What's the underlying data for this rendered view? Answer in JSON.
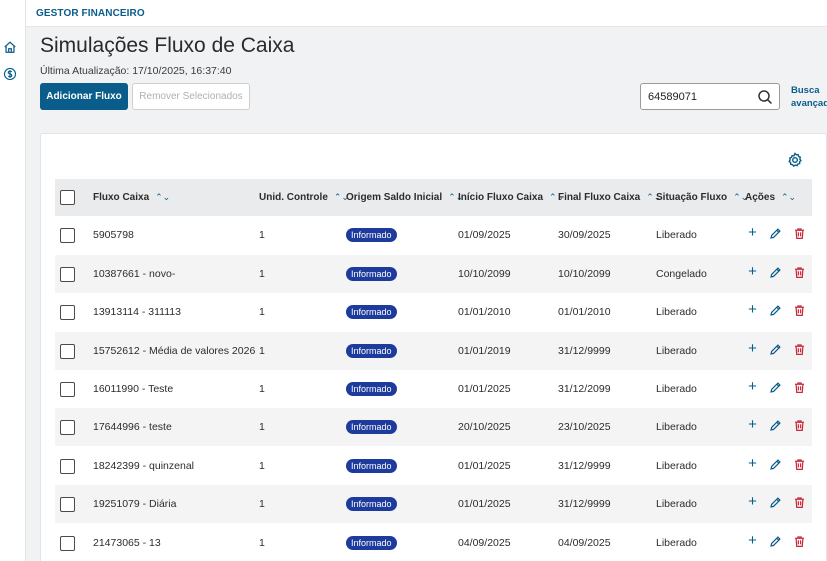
{
  "app": {
    "brand": "GESTOR FINANCEIRO"
  },
  "page": {
    "title": "Simulações Fluxo de Caixa",
    "last_update": "Última Atualização: 17/10/2025, 16:37:40"
  },
  "toolbar": {
    "add_label": "Adicionar Fluxo",
    "remove_label": "Remover Selecionados"
  },
  "search": {
    "value": "64589071",
    "advanced_label": "Busca avançada"
  },
  "table": {
    "columns": [
      "Fluxo Caixa",
      "Unid. Controle",
      "Origem Saldo Inicial",
      "Início Fluxo Caixa",
      "Final Fluxo Caixa",
      "Situação Fluxo",
      "Ações"
    ],
    "rows": [
      {
        "fluxo": "5905798",
        "unid": "1",
        "origem": "Informado",
        "inicio": "01/09/2025",
        "final": "30/09/2025",
        "situacao": "Liberado"
      },
      {
        "fluxo": "10387661 - novo-",
        "unid": "1",
        "origem": "Informado",
        "inicio": "10/10/2099",
        "final": "10/10/2099",
        "situacao": "Congelado"
      },
      {
        "fluxo": "13913114 - 311113",
        "unid": "1",
        "origem": "Informado",
        "inicio": "01/01/2010",
        "final": "01/01/2010",
        "situacao": "Liberado"
      },
      {
        "fluxo": "15752612 - Média de valores 2026",
        "unid": "1",
        "origem": "Informado",
        "inicio": "01/01/2019",
        "final": "31/12/9999",
        "situacao": "Liberado"
      },
      {
        "fluxo": "16011990 - Teste",
        "unid": "1",
        "origem": "Informado",
        "inicio": "01/01/2025",
        "final": "31/12/2099",
        "situacao": "Liberado"
      },
      {
        "fluxo": "17644996 - teste",
        "unid": "1",
        "origem": "Informado",
        "inicio": "20/10/2025",
        "final": "23/10/2025",
        "situacao": "Liberado"
      },
      {
        "fluxo": "18242399 - quinzenal",
        "unid": "1",
        "origem": "Informado",
        "inicio": "01/01/2025",
        "final": "31/12/9999",
        "situacao": "Liberado"
      },
      {
        "fluxo": "19251079 - Diária",
        "unid": "1",
        "origem": "Informado",
        "inicio": "01/01/2025",
        "final": "31/12/9999",
        "situacao": "Liberado"
      },
      {
        "fluxo": "21473065 - 13",
        "unid": "1",
        "origem": "Informado",
        "inicio": "04/09/2025",
        "final": "04/09/2025",
        "situacao": "Liberado"
      }
    ]
  },
  "colors": {
    "primary": "#0a5c8a",
    "badge": "#1d3b9c",
    "delete": "#c8283a"
  },
  "icons": [
    "home-icon",
    "currency-icon",
    "search-icon",
    "gear-icon",
    "sort-icon",
    "plus-icon",
    "edit-icon",
    "trash-icon"
  ]
}
